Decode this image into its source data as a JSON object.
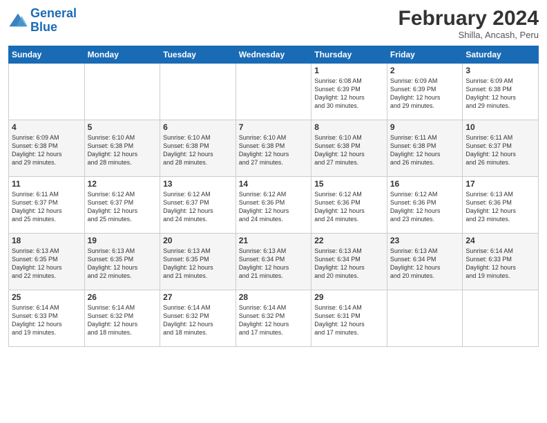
{
  "header": {
    "logo_line1": "General",
    "logo_line2": "Blue",
    "month_title": "February 2024",
    "subtitle": "Shilla, Ancash, Peru"
  },
  "days_of_week": [
    "Sunday",
    "Monday",
    "Tuesday",
    "Wednesday",
    "Thursday",
    "Friday",
    "Saturday"
  ],
  "weeks": [
    [
      {
        "day": "",
        "info": ""
      },
      {
        "day": "",
        "info": ""
      },
      {
        "day": "",
        "info": ""
      },
      {
        "day": "",
        "info": ""
      },
      {
        "day": "1",
        "info": "Sunrise: 6:08 AM\nSunset: 6:39 PM\nDaylight: 12 hours\nand 30 minutes."
      },
      {
        "day": "2",
        "info": "Sunrise: 6:09 AM\nSunset: 6:39 PM\nDaylight: 12 hours\nand 29 minutes."
      },
      {
        "day": "3",
        "info": "Sunrise: 6:09 AM\nSunset: 6:38 PM\nDaylight: 12 hours\nand 29 minutes."
      }
    ],
    [
      {
        "day": "4",
        "info": "Sunrise: 6:09 AM\nSunset: 6:38 PM\nDaylight: 12 hours\nand 29 minutes."
      },
      {
        "day": "5",
        "info": "Sunrise: 6:10 AM\nSunset: 6:38 PM\nDaylight: 12 hours\nand 28 minutes."
      },
      {
        "day": "6",
        "info": "Sunrise: 6:10 AM\nSunset: 6:38 PM\nDaylight: 12 hours\nand 28 minutes."
      },
      {
        "day": "7",
        "info": "Sunrise: 6:10 AM\nSunset: 6:38 PM\nDaylight: 12 hours\nand 27 minutes."
      },
      {
        "day": "8",
        "info": "Sunrise: 6:10 AM\nSunset: 6:38 PM\nDaylight: 12 hours\nand 27 minutes."
      },
      {
        "day": "9",
        "info": "Sunrise: 6:11 AM\nSunset: 6:38 PM\nDaylight: 12 hours\nand 26 minutes."
      },
      {
        "day": "10",
        "info": "Sunrise: 6:11 AM\nSunset: 6:37 PM\nDaylight: 12 hours\nand 26 minutes."
      }
    ],
    [
      {
        "day": "11",
        "info": "Sunrise: 6:11 AM\nSunset: 6:37 PM\nDaylight: 12 hours\nand 25 minutes."
      },
      {
        "day": "12",
        "info": "Sunrise: 6:12 AM\nSunset: 6:37 PM\nDaylight: 12 hours\nand 25 minutes."
      },
      {
        "day": "13",
        "info": "Sunrise: 6:12 AM\nSunset: 6:37 PM\nDaylight: 12 hours\nand 24 minutes."
      },
      {
        "day": "14",
        "info": "Sunrise: 6:12 AM\nSunset: 6:36 PM\nDaylight: 12 hours\nand 24 minutes."
      },
      {
        "day": "15",
        "info": "Sunrise: 6:12 AM\nSunset: 6:36 PM\nDaylight: 12 hours\nand 24 minutes."
      },
      {
        "day": "16",
        "info": "Sunrise: 6:12 AM\nSunset: 6:36 PM\nDaylight: 12 hours\nand 23 minutes."
      },
      {
        "day": "17",
        "info": "Sunrise: 6:13 AM\nSunset: 6:36 PM\nDaylight: 12 hours\nand 23 minutes."
      }
    ],
    [
      {
        "day": "18",
        "info": "Sunrise: 6:13 AM\nSunset: 6:35 PM\nDaylight: 12 hours\nand 22 minutes."
      },
      {
        "day": "19",
        "info": "Sunrise: 6:13 AM\nSunset: 6:35 PM\nDaylight: 12 hours\nand 22 minutes."
      },
      {
        "day": "20",
        "info": "Sunrise: 6:13 AM\nSunset: 6:35 PM\nDaylight: 12 hours\nand 21 minutes."
      },
      {
        "day": "21",
        "info": "Sunrise: 6:13 AM\nSunset: 6:34 PM\nDaylight: 12 hours\nand 21 minutes."
      },
      {
        "day": "22",
        "info": "Sunrise: 6:13 AM\nSunset: 6:34 PM\nDaylight: 12 hours\nand 20 minutes."
      },
      {
        "day": "23",
        "info": "Sunrise: 6:13 AM\nSunset: 6:34 PM\nDaylight: 12 hours\nand 20 minutes."
      },
      {
        "day": "24",
        "info": "Sunrise: 6:14 AM\nSunset: 6:33 PM\nDaylight: 12 hours\nand 19 minutes."
      }
    ],
    [
      {
        "day": "25",
        "info": "Sunrise: 6:14 AM\nSunset: 6:33 PM\nDaylight: 12 hours\nand 19 minutes."
      },
      {
        "day": "26",
        "info": "Sunrise: 6:14 AM\nSunset: 6:32 PM\nDaylight: 12 hours\nand 18 minutes."
      },
      {
        "day": "27",
        "info": "Sunrise: 6:14 AM\nSunset: 6:32 PM\nDaylight: 12 hours\nand 18 minutes."
      },
      {
        "day": "28",
        "info": "Sunrise: 6:14 AM\nSunset: 6:32 PM\nDaylight: 12 hours\nand 17 minutes."
      },
      {
        "day": "29",
        "info": "Sunrise: 6:14 AM\nSunset: 6:31 PM\nDaylight: 12 hours\nand 17 minutes."
      },
      {
        "day": "",
        "info": ""
      },
      {
        "day": "",
        "info": ""
      }
    ]
  ]
}
